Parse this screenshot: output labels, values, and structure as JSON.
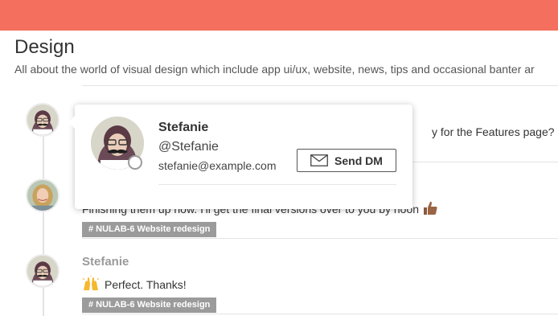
{
  "colors": {
    "topbar": "#f46f5e",
    "tag_bg": "#9b9b9b",
    "presence_ring": "#9b9b9b"
  },
  "channel": {
    "title": "Design",
    "description": "All about the world of visual design which include app ui/ux, website, news, tips and occasional banter ar"
  },
  "messages": [
    {
      "text_partial": "y for the Features page?"
    },
    {
      "text": "Finishing them up now. I'll get the final versions over to you by noon",
      "emoji": "thumbs-up-icon",
      "tag": "# NULAB-6 Website redesign"
    },
    {
      "author": "Stefanie",
      "text": "Perfect. Thanks!",
      "emoji": "raised-hands-icon",
      "tag": "# NULAB-6 Website redesign"
    }
  ],
  "popover": {
    "name": "Stefanie",
    "handle": "@Stefanie",
    "email": "stefanie@example.com",
    "presence": "offline",
    "send_dm_label": "Send DM",
    "send_dm_icon": "envelope-icon"
  }
}
